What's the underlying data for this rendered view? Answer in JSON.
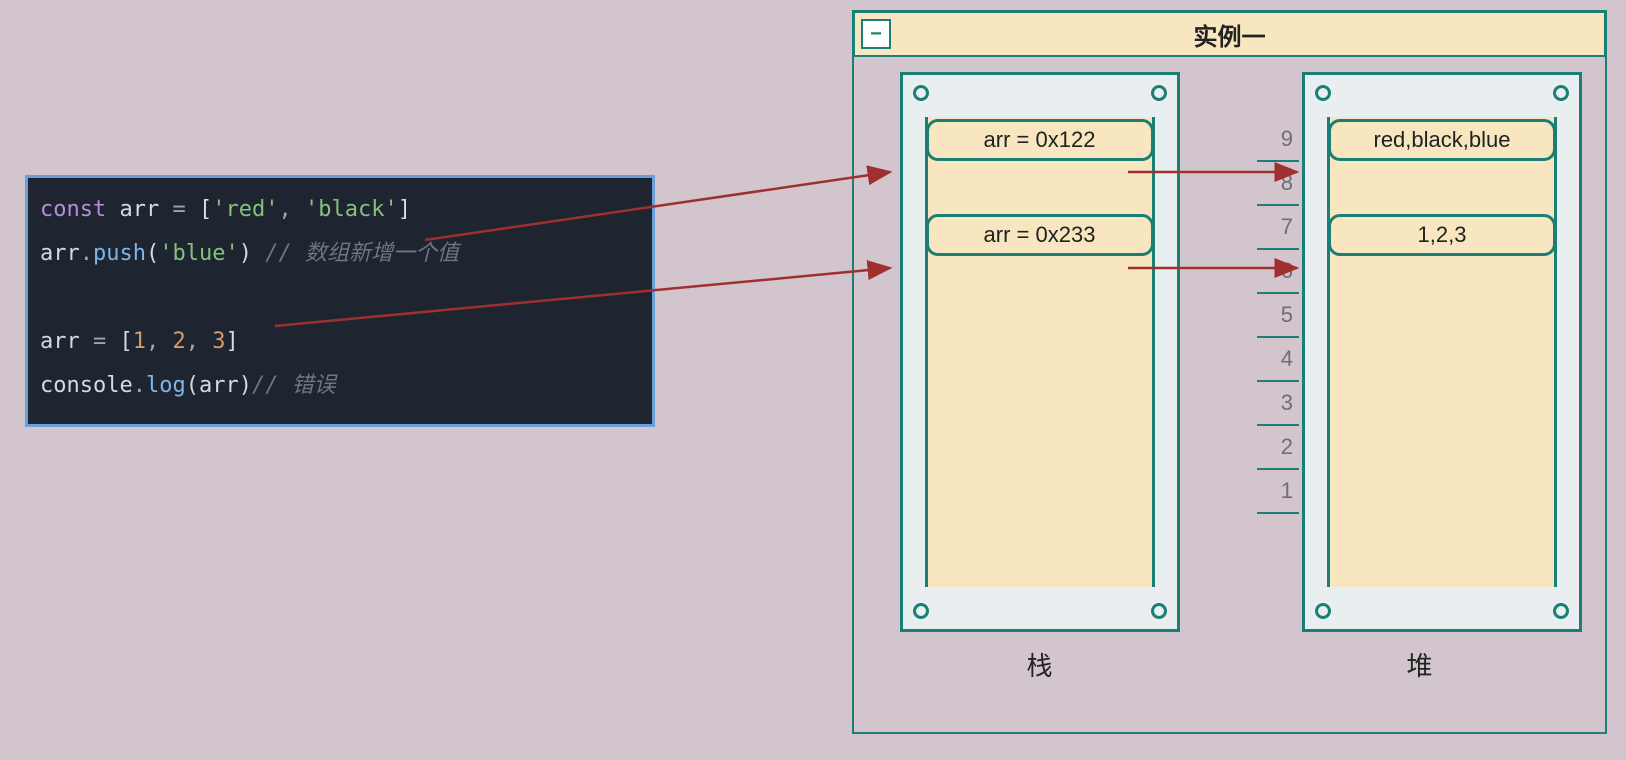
{
  "code": {
    "line1": {
      "kw": "const",
      "var": "arr",
      "op": "=",
      "brk_open": "[",
      "str1": "'red'",
      "comma": ",",
      "str2": "'black'",
      "brk_close": "]"
    },
    "line2": {
      "var": "arr",
      "dot": ".",
      "fn": "push",
      "paren_open": "(",
      "str": "'blue'",
      "paren_close": ")",
      "cmt": "// 数组新增一个值"
    },
    "line3": {
      "empty": " "
    },
    "line4": {
      "var": "arr",
      "op": "=",
      "brk_open": "[",
      "n1": "1",
      "c1": ",",
      "n2": "2",
      "c2": ",",
      "n3": "3",
      "brk_close": "]"
    },
    "line5": {
      "obj": "console",
      "dot": ".",
      "fn": "log",
      "paren_open": "(",
      "arg": "arr",
      "paren_close": ")",
      "cmt": "// 错误"
    }
  },
  "panel": {
    "title": "实例一",
    "collapse_glyph": "−",
    "stack_label": "栈",
    "heap_label": "堆"
  },
  "stack": {
    "cell1": "arr = 0x122",
    "cell2": "arr = 0x233"
  },
  "heap": {
    "cell1": "red,black,blue",
    "cell2": "1,2,3",
    "ticks": [
      "9",
      "8",
      "7",
      "6",
      "5",
      "4",
      "3",
      "2",
      "1"
    ]
  }
}
